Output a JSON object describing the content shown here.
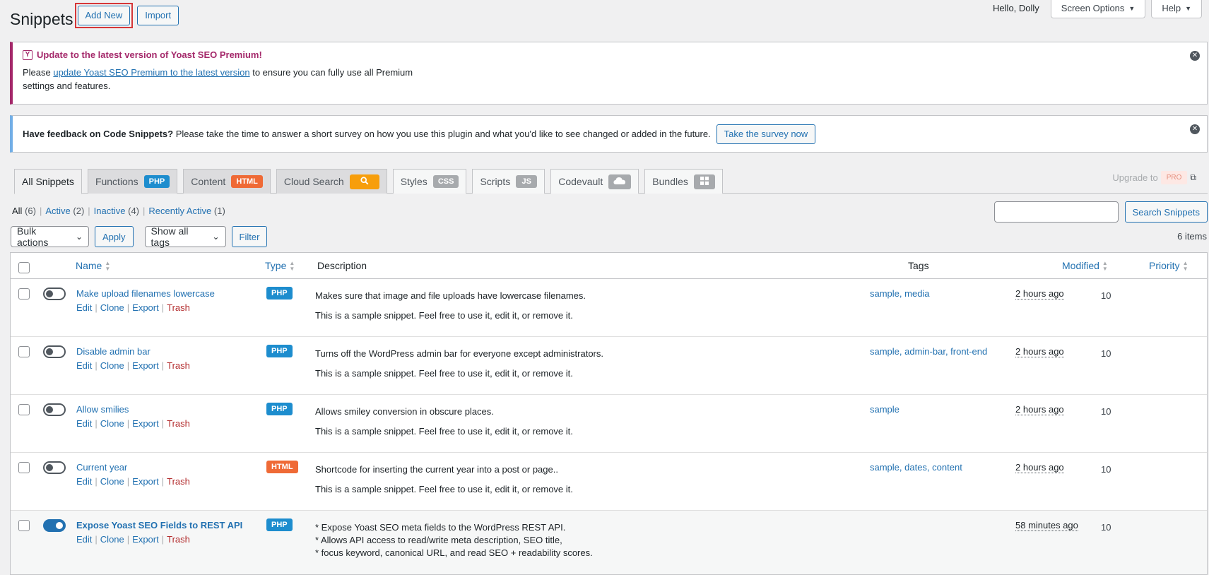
{
  "screen_meta": {
    "greeting": "Hello, Dolly",
    "screen_options": "Screen Options",
    "help": "Help"
  },
  "header": {
    "title": "Snippets",
    "add_new": "Add New",
    "import": "Import"
  },
  "yoast_notice": {
    "logo": "Y",
    "title": "Update to the latest version of Yoast SEO Premium!",
    "body_prefix": "Please ",
    "link": "update Yoast SEO Premium to the latest version",
    "body_suffix": " to ensure you can fully use all Premium settings and features."
  },
  "survey_notice": {
    "bold": "Have feedback on Code Snippets?",
    "text": " Please take the time to answer a short survey on how you use this plugin and what you'd like to see changed or added in the future.",
    "button": "Take the survey now"
  },
  "type_tabs": [
    {
      "label": "All Snippets",
      "badge": ""
    },
    {
      "label": "Functions",
      "badge": "PHP"
    },
    {
      "label": "Content",
      "badge": "HTML"
    },
    {
      "label": "Cloud Search",
      "badge": "search-icon"
    },
    {
      "label": "Styles",
      "badge": "CSS"
    },
    {
      "label": "Scripts",
      "badge": "JS"
    },
    {
      "label": "Codevault",
      "badge": "cloud-icon"
    },
    {
      "label": "Bundles",
      "badge": "grid-icon"
    }
  ],
  "upgrade": {
    "label": "Upgrade to",
    "pro": "PRO"
  },
  "views": [
    {
      "label": "All",
      "count": "(6)"
    },
    {
      "label": "Active",
      "count": "(2)"
    },
    {
      "label": "Inactive",
      "count": "(4)"
    },
    {
      "label": "Recently Active",
      "count": "(1)"
    }
  ],
  "search": {
    "button": "Search Snippets",
    "value": ""
  },
  "tablenav": {
    "bulk_actions": "Bulk actions",
    "apply": "Apply",
    "tags_filter": "Show all tags",
    "filter": "Filter",
    "items_count": "6 items"
  },
  "columns": {
    "name": "Name",
    "type": "Type",
    "description": "Description",
    "tags": "Tags",
    "modified": "Modified",
    "priority": "Priority"
  },
  "row_actions": {
    "edit": "Edit",
    "clone": "Clone",
    "export": "Export",
    "trash": "Trash"
  },
  "rows": [
    {
      "name": "Make upload filenames lowercase",
      "type": "PHP",
      "active": false,
      "desc": [
        "Makes sure that image and file uploads have lowercase filenames.",
        "This is a sample snippet. Feel free to use it, edit it, or remove it."
      ],
      "tags": "sample, media",
      "modified": "2 hours ago",
      "priority": "10"
    },
    {
      "name": "Disable admin bar",
      "type": "PHP",
      "active": false,
      "desc": [
        "Turns off the WordPress admin bar for everyone except administrators.",
        "This is a sample snippet. Feel free to use it, edit it, or remove it."
      ],
      "tags": "sample, admin-bar, front-end",
      "modified": "2 hours ago",
      "priority": "10"
    },
    {
      "name": "Allow smilies",
      "type": "PHP",
      "active": false,
      "desc": [
        "Allows smiley conversion in obscure places.",
        "This is a sample snippet. Feel free to use it, edit it, or remove it."
      ],
      "tags": "sample",
      "modified": "2 hours ago",
      "priority": "10"
    },
    {
      "name": "Current year",
      "type": "HTML",
      "active": false,
      "desc": [
        "Shortcode for inserting the current year into a post or page..",
        "This is a sample snippet. Feel free to use it, edit it, or remove it."
      ],
      "tags": "sample, dates, content",
      "modified": "2 hours ago",
      "priority": "10"
    },
    {
      "name": "Expose Yoast SEO Fields to REST API",
      "type": "PHP",
      "active": true,
      "desc": [
        "* Expose Yoast SEO meta fields to the WordPress REST API.",
        "* Allows API access to read/write meta description, SEO title,",
        "* focus keyword, canonical URL, and read SEO + readability scores."
      ],
      "tags": "",
      "modified": "58 minutes ago",
      "priority": "10"
    }
  ]
}
